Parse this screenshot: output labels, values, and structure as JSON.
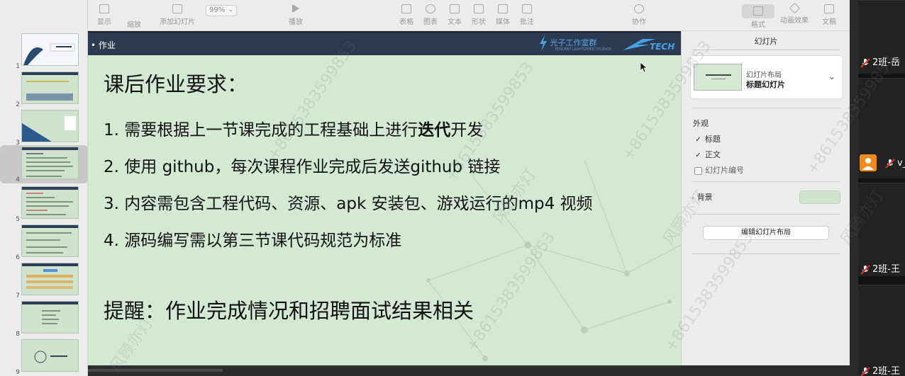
{
  "toolbar": {
    "zoom_value": "99%",
    "items": [
      {
        "key": "view",
        "label": "显示"
      },
      {
        "key": "zoom",
        "label": "缩放"
      },
      {
        "key": "add_slide",
        "label": "添加幻灯片"
      },
      {
        "key": "play",
        "label": "播放"
      },
      {
        "key": "table",
        "label": "表格"
      },
      {
        "key": "chart",
        "label": "图表"
      },
      {
        "key": "text",
        "label": "文本"
      },
      {
        "key": "shape",
        "label": "形状"
      },
      {
        "key": "media",
        "label": "媒体"
      },
      {
        "key": "comment",
        "label": "批注"
      },
      {
        "key": "collaborate",
        "label": "协作"
      },
      {
        "key": "format",
        "label": "格式"
      },
      {
        "key": "animate",
        "label": "动画效果"
      },
      {
        "key": "document",
        "label": "文稿"
      }
    ]
  },
  "thumbnails": {
    "numbers": [
      "1",
      "2",
      "3",
      "4",
      "5",
      "6",
      "7",
      "8",
      "9"
    ],
    "selected": "4"
  },
  "slide": {
    "header_title": "作业",
    "studio_logo": "光子工作室群",
    "studio_logo_sub": "TENCENT LIGHTSPEED STUDIOS",
    "tech_logo": "TECH",
    "heading": "课后作业要求：",
    "items": [
      {
        "num": "1.",
        "before": "需要根据上一节课完成的工程基础上进行",
        "bold": "迭代",
        "after": "开发"
      },
      {
        "num": "2.",
        "before": "使用 github，每次课程作业完成后发送github 链接",
        "bold": "",
        "after": ""
      },
      {
        "num": "3.",
        "before": "内容需包含工程代码、资源、apk 安装包、游戏运行的mp4 视频",
        "bold": "",
        "after": ""
      },
      {
        "num": "4.",
        "before": "源码编写需以第三节课代码规范为标准",
        "bold": "",
        "after": ""
      }
    ],
    "reminder": "提醒：作业完成情况和招聘面试结果相关"
  },
  "panel": {
    "title": "幻灯片",
    "layout_label": "幻灯片布局",
    "layout_value": "标题幻灯片",
    "layout_thumb_title": "Lorem Ipsum Dolor",
    "appearance_title": "外观",
    "check_title": "标题",
    "check_body": "正文",
    "check_slide_number": "幻灯片编号",
    "check_states": {
      "title": true,
      "body": true,
      "slide_number": false
    },
    "background_label": "背景",
    "background_color": "#cfe3cf",
    "edit_layout_button": "编辑幻灯片布局"
  },
  "video": {
    "participants": [
      {
        "label": "2班-岳",
        "muted": true
      },
      {
        "label": "v_",
        "muted": true
      },
      {
        "label": "2班-王",
        "muted": true
      },
      {
        "label": "2班-王",
        "muted": true
      }
    ]
  },
  "watermark": {
    "text_1": "风顾亦灯",
    "text_2": "+8615383599853"
  }
}
